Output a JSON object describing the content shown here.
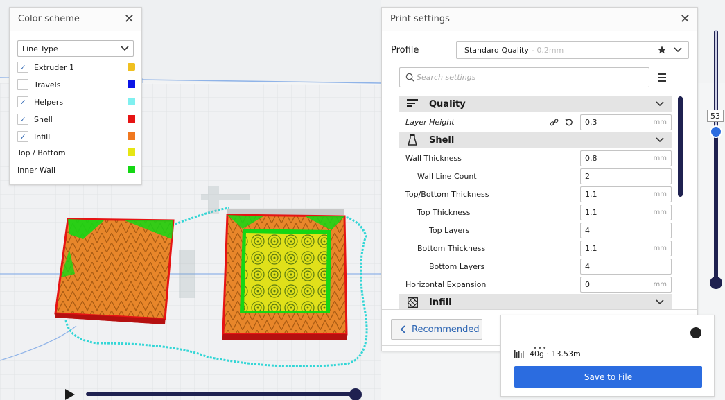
{
  "color_scheme": {
    "title": "Color scheme",
    "close_label": "✕",
    "dropdown_value": "Line Type",
    "items": [
      {
        "label": "Extruder 1",
        "checked": true,
        "color": "#f0c020"
      },
      {
        "label": "Travels",
        "checked": false,
        "color": "#0a14e6"
      },
      {
        "label": "Helpers",
        "checked": true,
        "color": "#80f0f0"
      },
      {
        "label": "Shell",
        "checked": true,
        "color": "#e61414"
      },
      {
        "label": "Infill",
        "checked": true,
        "color": "#f07820"
      },
      {
        "label": "Top / Bottom",
        "checked": null,
        "color": "#e6e614"
      },
      {
        "label": "Inner Wall",
        "checked": null,
        "color": "#14d714"
      }
    ]
  },
  "print_settings": {
    "title": "Print settings",
    "close_label": "✕",
    "profile_label": "Profile",
    "profile_value": "Standard Quality",
    "profile_sub": " - 0.2mm",
    "search_placeholder": "Search settings",
    "categories": {
      "quality": "Quality",
      "shell": "Shell",
      "infill": "Infill"
    },
    "settings": [
      {
        "label": "Layer Height",
        "value": "0.3",
        "unit": "mm"
      },
      {
        "label": "Wall Thickness",
        "value": "0.8",
        "unit": "mm"
      },
      {
        "label": "Wall Line Count",
        "value": "2",
        "unit": ""
      },
      {
        "label": "Top/Bottom Thickness",
        "value": "1.1",
        "unit": "mm"
      },
      {
        "label": "Top Thickness",
        "value": "1.1",
        "unit": "mm"
      },
      {
        "label": "Top Layers",
        "value": "4",
        "unit": ""
      },
      {
        "label": "Bottom Thickness",
        "value": "1.1",
        "unit": "mm"
      },
      {
        "label": "Bottom Layers",
        "value": "4",
        "unit": ""
      },
      {
        "label": "Horizontal Expansion",
        "value": "0",
        "unit": "mm"
      }
    ],
    "recommended_label": "Recommended"
  },
  "output": {
    "estimate": "40g · 13.53m",
    "save_label": "Save to File"
  },
  "layer_slider": {
    "current_layer": "53"
  },
  "colors": {
    "accent": "#2b6ce0",
    "slider": "#1f2150"
  }
}
